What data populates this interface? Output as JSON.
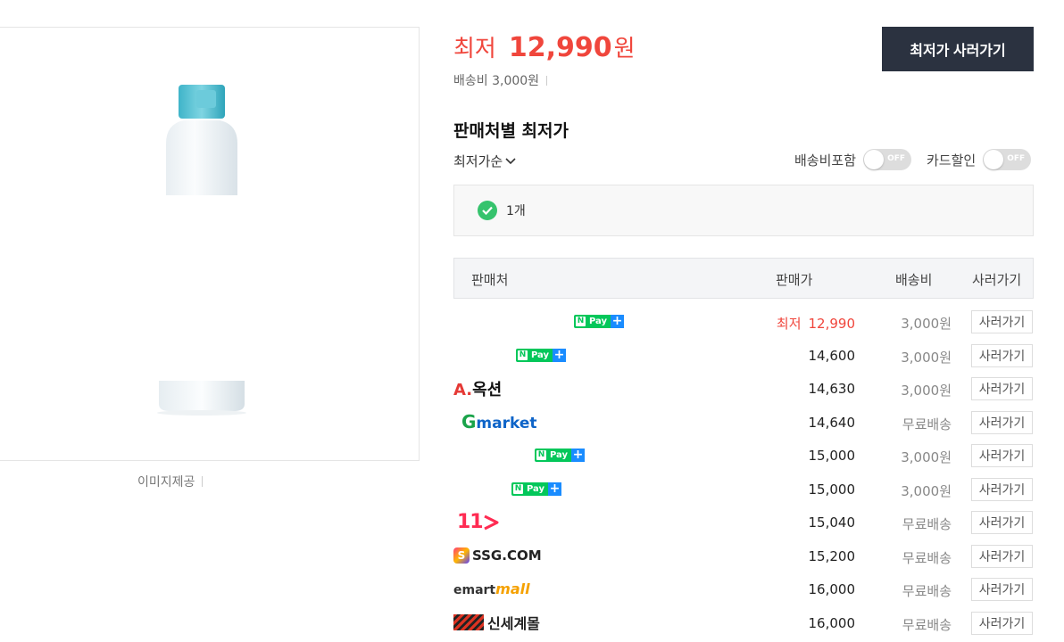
{
  "image": {
    "credit": "이미지제공"
  },
  "price": {
    "label": "최저",
    "value": "12,990",
    "unit": "원",
    "shipping": "배송비 3,000원"
  },
  "buttons": {
    "buy_lowest": "최저가 사러가기"
  },
  "sellers_section": {
    "title": "판매처별 최저가",
    "sort": "최저가순",
    "toggles": [
      {
        "label": "배송비포함",
        "state": "OFF"
      },
      {
        "label": "카드할인",
        "state": "OFF"
      }
    ],
    "filter_count": "1개"
  },
  "table": {
    "headers": {
      "seller": "판매처",
      "price": "판매가",
      "shipping": "배송비",
      "buy": "사러가기"
    },
    "rows": [
      {
        "logo": "npay",
        "price": "12,990",
        "price_label": "최저",
        "shipping": "3,000원",
        "buy": "사러가기"
      },
      {
        "logo": "npay",
        "price": "14,600",
        "shipping": "3,000원",
        "buy": "사러가기"
      },
      {
        "logo": "auction",
        "logo_text": "옥션",
        "logo_mark": "A.",
        "price": "14,630",
        "shipping": "3,000원",
        "buy": "사러가기"
      },
      {
        "logo": "gmarket",
        "logo_mark": "G",
        "logo_text": "market",
        "price": "14,640",
        "shipping": "무료배송",
        "buy": "사러가기"
      },
      {
        "logo": "npay",
        "price": "15,000",
        "shipping": "3,000원",
        "buy": "사러가기"
      },
      {
        "logo": "npay",
        "price": "15,000",
        "shipping": "3,000원",
        "buy": "사러가기"
      },
      {
        "logo": "11st",
        "logo_text": "11",
        "price": "15,040",
        "shipping": "무료배송",
        "buy": "사러가기"
      },
      {
        "logo": "ssg",
        "logo_mark": "S",
        "logo_text": "SSG.COM",
        "price": "15,200",
        "shipping": "무료배송",
        "buy": "사러가기"
      },
      {
        "logo": "emart",
        "logo_mark": "emart",
        "logo_text": "mall",
        "price": "16,000",
        "shipping": "무료배송",
        "buy": "사러가기"
      },
      {
        "logo": "shinsegae",
        "logo_text": "신세계몰",
        "price": "16,000",
        "shipping": "무료배송",
        "buy": "사러가기"
      }
    ]
  },
  "npay_badge": {
    "n": "N",
    "pay": "Pay",
    "plus": "+"
  },
  "colors": {
    "accent_red": "#f0463c",
    "dark_button": "#2b3240",
    "npay_green": "#03c75a",
    "check_green": "#36c36d"
  }
}
